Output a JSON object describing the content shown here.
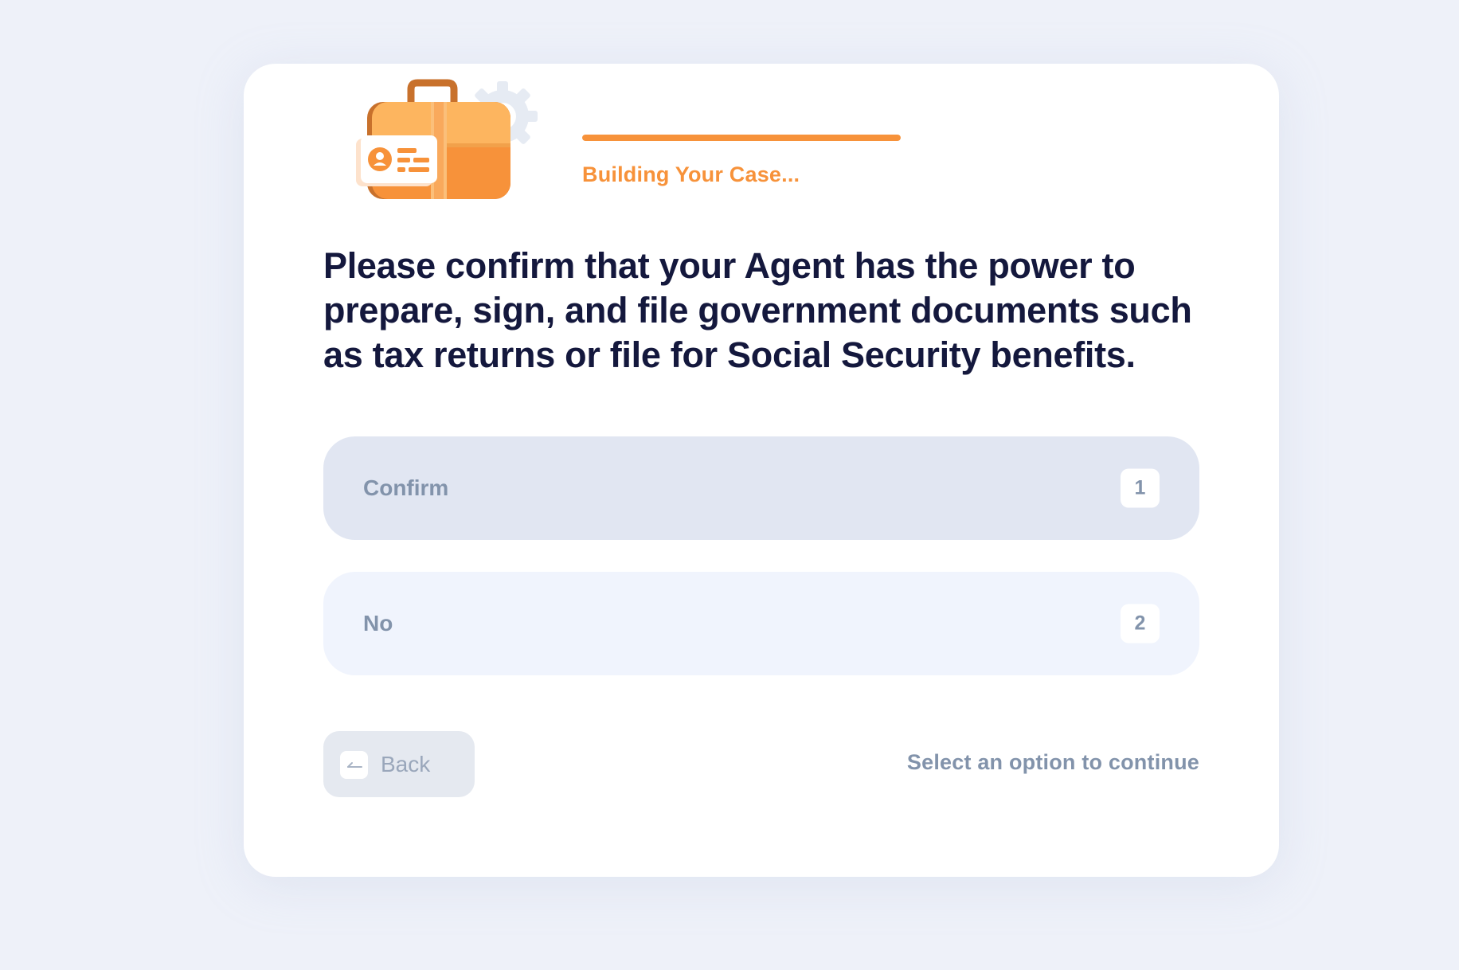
{
  "progress": {
    "label": "Building Your Case...",
    "fraction": 1.0
  },
  "question": {
    "text": "Please confirm that your Agent has the power to prepare, sign, and file government documents such as tax returns or file for Social Security benefits."
  },
  "options": [
    {
      "label": "Confirm",
      "key": "1"
    },
    {
      "label": "No",
      "key": "2"
    }
  ],
  "footer": {
    "back_label": "Back",
    "hint": "Select an option to continue"
  },
  "icons": {
    "illustration": "briefcase-gear-id-card-icon",
    "back": "arrow-left-icon"
  },
  "colors": {
    "accent": "#f7923a",
    "heading": "#14183d",
    "muted": "#8293ab",
    "option_selected_bg": "#e1e6f2",
    "option_bg": "#f0f4fd",
    "page_bg": "#eef1f9"
  }
}
